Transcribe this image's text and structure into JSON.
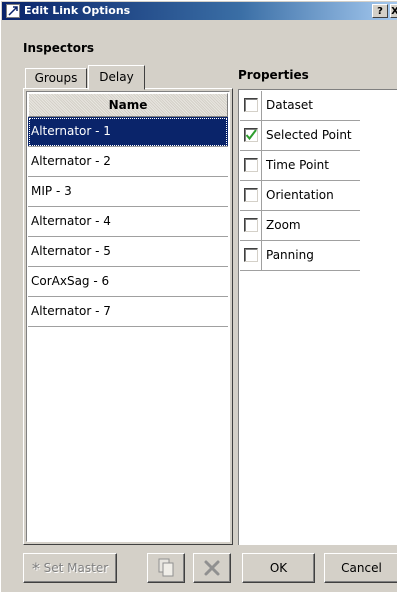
{
  "window": {
    "title": "Edit Link Options",
    "help_label": "?",
    "close_label": "X"
  },
  "inspectors": {
    "heading": "Inspectors",
    "tabs": [
      {
        "label": "Groups",
        "active": false
      },
      {
        "label": "Delay",
        "active": true
      }
    ],
    "column_header": "Name",
    "items": [
      {
        "label": "Alternator - 1",
        "selected": true
      },
      {
        "label": "Alternator - 2",
        "selected": false
      },
      {
        "label": "MIP - 3",
        "selected": false
      },
      {
        "label": "Alternator - 4",
        "selected": false
      },
      {
        "label": "Alternator - 5",
        "selected": false
      },
      {
        "label": "CorAxSag - 6",
        "selected": false
      },
      {
        "label": "Alternator - 7",
        "selected": false
      }
    ]
  },
  "properties": {
    "heading": "Properties",
    "items": [
      {
        "label": "Dataset",
        "checked": false
      },
      {
        "label": "Selected Point",
        "checked": true
      },
      {
        "label": "Time Point",
        "checked": false
      },
      {
        "label": "Orientation",
        "checked": false
      },
      {
        "label": "Zoom",
        "checked": false
      },
      {
        "label": "Panning",
        "checked": false
      }
    ]
  },
  "footer": {
    "set_master_label": "Set Master",
    "set_master_icon": "asterisk-icon",
    "copy_icon": "copy-icon",
    "delete_icon": "delete-icon",
    "ok_label": "OK",
    "cancel_label": "Cancel"
  },
  "colors": {
    "selection": "#0a246a",
    "checkmark": "#2e9e2e"
  }
}
